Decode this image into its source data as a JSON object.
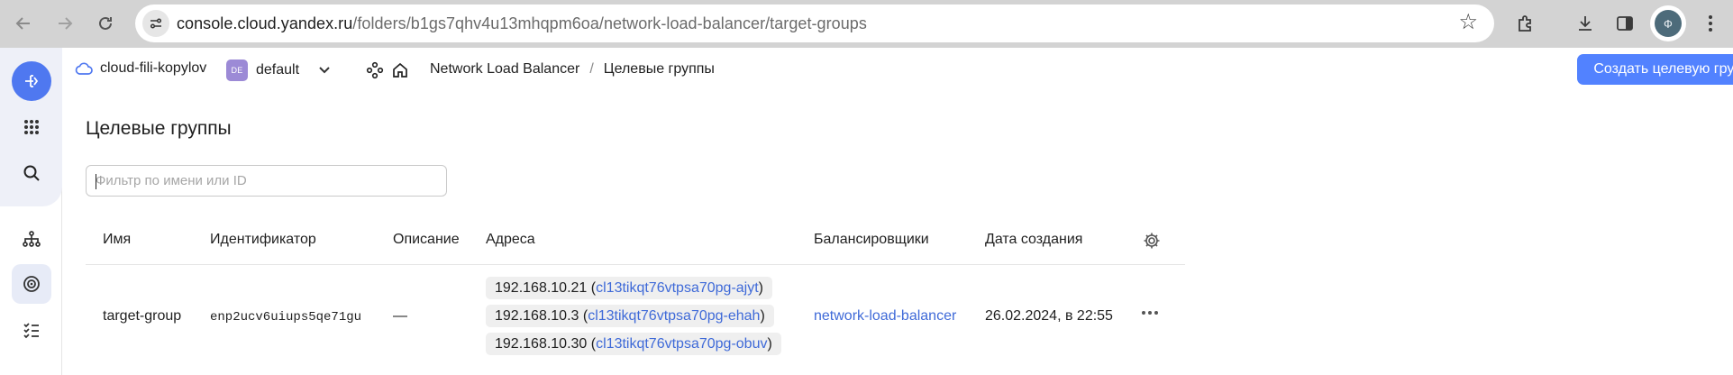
{
  "browser": {
    "url_host": "console.cloud.yandex.ru",
    "url_path": "/folders/b1gs7qhv4u13mhqpm6oa/network-load-balancer/target-groups",
    "profile_initial": "Ф"
  },
  "topbar": {
    "cloud_name": "cloud-fili-kopylov",
    "folder_badge": "DE",
    "folder_name": "default",
    "breadcrumb_service": "Network Load Balancer",
    "breadcrumb_sep": "/",
    "breadcrumb_current": "Целевые группы",
    "create_button": "Создать целевую группу"
  },
  "page": {
    "title": "Целевые группы",
    "filter_placeholder": "Фильтр по имени или ID"
  },
  "table": {
    "columns": [
      "Имя",
      "Идентификатор",
      "Описание",
      "Адреса",
      "Балансировщики",
      "Дата создания"
    ],
    "rows": [
      {
        "name": "target-group",
        "id": "enp2ucv6uiups5qe71gu",
        "description": "—",
        "addresses": [
          {
            "ip": "192.168.10.21",
            "open": " (",
            "instance": "cl13tikqt76vtpsa70pg-ajyt",
            "close": ")"
          },
          {
            "ip": "192.168.10.3",
            "open": " (",
            "instance": "cl13tikqt76vtpsa70pg-ehah",
            "close": ")"
          },
          {
            "ip": "192.168.10.30",
            "open": " (",
            "instance": "cl13tikqt76vtpsa70pg-obuv",
            "close": ")"
          }
        ],
        "balancer": "network-load-balancer",
        "created": "26.02.2024, в 22:55"
      }
    ]
  },
  "colors": {
    "accent": "#5282ff",
    "link": "#3f6ad8",
    "brand": "#4f78f0",
    "folder_badge": "#9c8ad6"
  }
}
